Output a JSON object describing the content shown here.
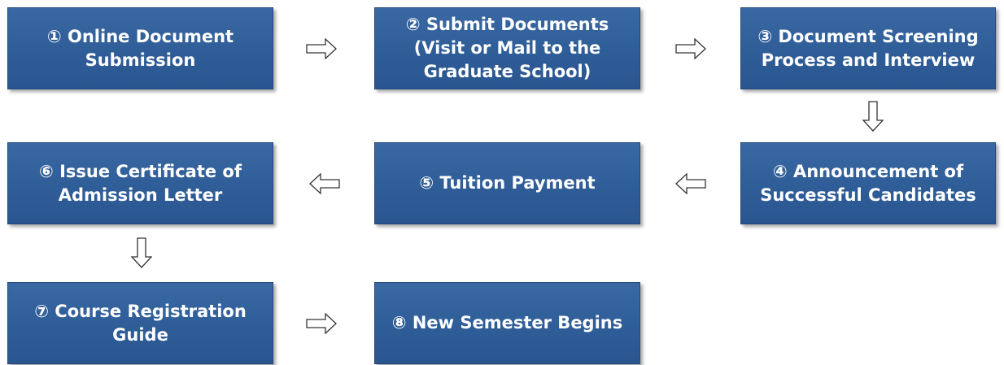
{
  "steps": [
    {
      "id": 1,
      "label": "① Online Document\nSubmission"
    },
    {
      "id": 2,
      "label": "② Submit Documents\n(Visit or Mail to the\nGraduate School)"
    },
    {
      "id": 3,
      "label": "③ Document Screening\nProcess and Interview"
    },
    {
      "id": 4,
      "label": "④ Announcement of\nSuccessful Candidates"
    },
    {
      "id": 5,
      "label": "⑤ Tuition Payment"
    },
    {
      "id": 6,
      "label": "⑥ Issue Certificate of\nAdmission Letter"
    },
    {
      "id": 7,
      "label": "⑦ Course Registration\nGuide"
    },
    {
      "id": 8,
      "label": "⑧ New Semester Begins"
    }
  ],
  "connectors": [
    {
      "from": 1,
      "to": 2,
      "icon": "arrow-right-icon"
    },
    {
      "from": 2,
      "to": 3,
      "icon": "arrow-right-icon"
    },
    {
      "from": 3,
      "to": 4,
      "icon": "arrow-down-icon"
    },
    {
      "from": 4,
      "to": 5,
      "icon": "arrow-left-icon"
    },
    {
      "from": 5,
      "to": 6,
      "icon": "arrow-left-icon"
    },
    {
      "from": 6,
      "to": 7,
      "icon": "arrow-down-icon"
    },
    {
      "from": 7,
      "to": 8,
      "icon": "arrow-right-icon"
    }
  ],
  "colors": {
    "box_fill": "#2f5d97",
    "box_text": "#ffffff",
    "arrow_stroke": "#333333"
  }
}
